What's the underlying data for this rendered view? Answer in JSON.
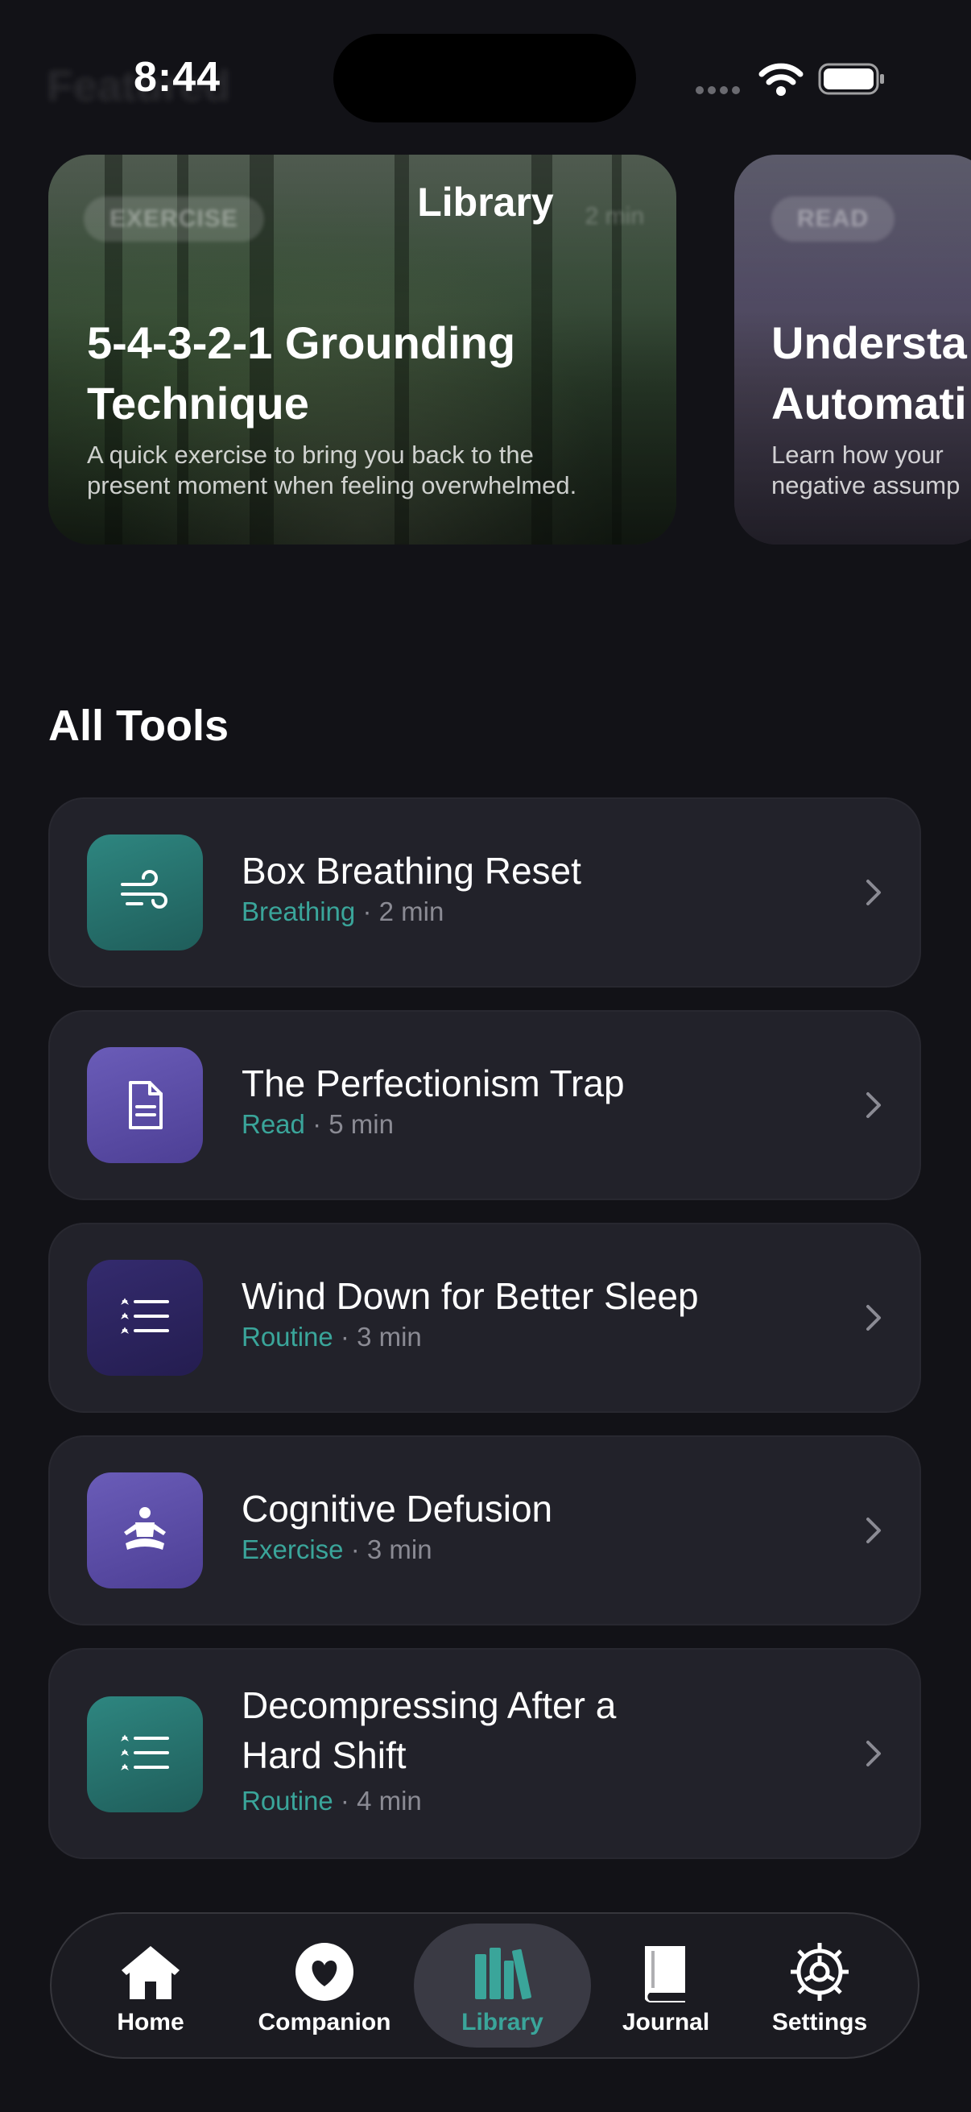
{
  "status_bar": {
    "time": "8:44"
  },
  "header": {
    "title": "Library",
    "featured_label": "Featured"
  },
  "featured": [
    {
      "tag": "EXERCISE",
      "duration": "2 min",
      "title_line1": "5-4-3-2-1 Grounding",
      "title_line2": "Technique",
      "desc_line1": "A quick exercise to bring you back to the",
      "desc_line2": "present moment when feeling overwhelmed."
    },
    {
      "tag": "READ",
      "title_line1": "Understa",
      "title_line2": "Automati",
      "desc_line1": "Learn how your",
      "desc_line2": "negative assump"
    }
  ],
  "section": {
    "title": "All Tools"
  },
  "tools": [
    {
      "title": "Box Breathing Reset",
      "category": "Breathing",
      "separator": "·",
      "duration": "2 min",
      "icon": "wind-icon",
      "color": "#2e8680"
    },
    {
      "title": "The Perfectionism Trap",
      "category": "Read",
      "separator": "·",
      "duration": "5 min",
      "icon": "document-icon",
      "color": "#6a5cb8"
    },
    {
      "title": "Wind Down for Better Sleep",
      "category": "Routine",
      "separator": "·",
      "duration": "3 min",
      "icon": "checklist-icon",
      "color": "#342b6e"
    },
    {
      "title": "Cognitive Defusion",
      "category": "Exercise",
      "separator": "·",
      "duration": "3 min",
      "icon": "meditation-icon",
      "color": "#6a5cb8"
    },
    {
      "title_line1": "Decompressing After a",
      "title_line2": "Hard Shift",
      "category": "Routine",
      "separator": "·",
      "duration": "4 min",
      "icon": "checklist-icon",
      "color": "#2e8680"
    }
  ],
  "tab_bar": {
    "active": "Library",
    "items": [
      {
        "label": "Home",
        "icon": "home-icon"
      },
      {
        "label": "Companion",
        "icon": "heart-icon"
      },
      {
        "label": "Library",
        "icon": "books-icon"
      },
      {
        "label": "Journal",
        "icon": "book-icon"
      },
      {
        "label": "Settings",
        "icon": "gear-icon"
      }
    ]
  },
  "colors": {
    "accent": "#3aa59a",
    "background": "#121217",
    "card": "#22222a"
  }
}
